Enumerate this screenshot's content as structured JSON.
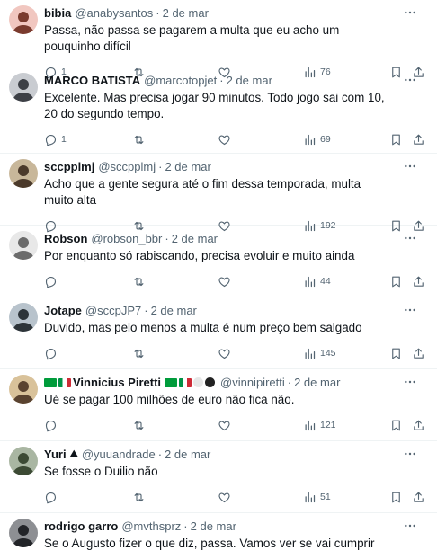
{
  "colors": {
    "text": "#0f1419",
    "secondary": "#536471",
    "divider": "#eff3f4"
  },
  "icons": [
    "more-icon",
    "reply-icon",
    "retweet-icon",
    "like-icon",
    "views-icon",
    "bookmark-icon",
    "share-icon"
  ],
  "tweets": [
    {
      "name": "bibia",
      "handle": "@anabysantos",
      "separator": "·",
      "date": "2 de mar",
      "text": "Passa, não passa se pagarem a multa que eu acho um pouquinho difícil",
      "replies": "1",
      "retweets": "",
      "likes": "",
      "views": "76",
      "lines": 1
    },
    {
      "name": "MARCO BATISTA",
      "handle": "@marcotopjet",
      "separator": "·",
      "date": "2 de mar",
      "text": "Excelente. Mas precisa jogar 90 minutos. Todo jogo sai com 10, 20 do segundo tempo.",
      "replies": "1",
      "retweets": "",
      "likes": "",
      "views": "69",
      "lines": 2
    },
    {
      "name": "sccpplmj",
      "handle": "@sccpplmj",
      "separator": "·",
      "date": "2 de mar",
      "text": "Acho que a gente segura até o fim dessa temporada, multa muito alta",
      "replies": "",
      "retweets": "",
      "likes": "",
      "views": "192",
      "lines": 1
    },
    {
      "name": "Robson",
      "handle": "@robson_bbr",
      "separator": "·",
      "date": "2 de mar",
      "text": "Por enquanto só rabiscando, precisa evoluir e muito ainda",
      "replies": "",
      "retweets": "",
      "likes": "",
      "views": "44",
      "lines": 1
    },
    {
      "name": "Jotape",
      "handle": "@sccpJP7",
      "separator": "·",
      "date": "2 de mar",
      "text": "Duvido, mas pelo menos a multa é num preço bem salgado",
      "replies": "",
      "retweets": "",
      "likes": "",
      "views": "145",
      "lines": 1
    },
    {
      "name": "Vinnicius Piretti",
      "handle": "@vinnipiretti",
      "separator": "·",
      "date": "2 de mar",
      "text": "Ué se pagar 100 milhões de euro não fica não.",
      "replies": "",
      "retweets": "",
      "likes": "",
      "views": "121",
      "lines": 1
    },
    {
      "name": "Yuri",
      "handle": "@yuuandrade",
      "separator": "·",
      "date": "2 de mar",
      "text": "Se fosse o Duilio não",
      "replies": "",
      "retweets": "",
      "likes": "",
      "views": "51",
      "lines": 1
    },
    {
      "name": "rodrigo garro",
      "handle": "@mvthsprz",
      "separator": "·",
      "date": "2 de mar",
      "text": "Se o Augusto fizer o que diz, passa. Vamos ver se vai cumprir",
      "replies": "",
      "retweets": "",
      "likes": "",
      "views": "",
      "lines": 1
    }
  ]
}
